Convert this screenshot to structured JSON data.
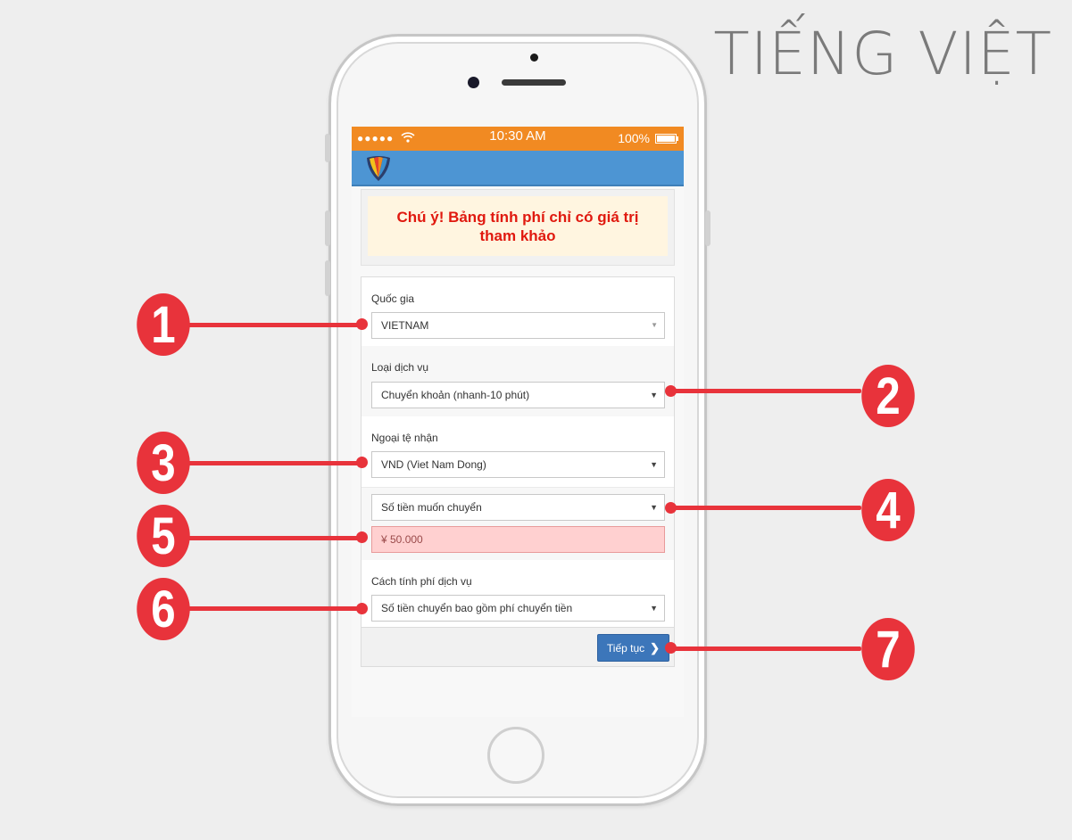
{
  "heading": "TIẾNG VIỆT",
  "status_bar": {
    "signal": "●●●●●",
    "time": "10:30 AM",
    "battery": "100%"
  },
  "notice": "Chú ý! Bảng tính phí chỉ có giá trị tham khảo",
  "form": {
    "country": {
      "label": "Quốc gia",
      "value": "VIETNAM"
    },
    "service_type": {
      "label": "Loại dịch vụ",
      "value": "Chuyển khoản (nhanh-10 phút)"
    },
    "currency": {
      "label": "Ngoại tệ nhận",
      "value": "VND (Viet Nam Dong)"
    },
    "amount_type": {
      "value": "Số tiền muốn chuyển"
    },
    "amount": {
      "value": "¥ 50.000"
    },
    "fee_method": {
      "label": "Cách tính phí dịch vụ",
      "value": "Số tiền chuyển bao gồm phí chuyển tiền"
    },
    "next_button": "Tiếp tục"
  },
  "callouts": [
    "1",
    "2",
    "3",
    "4",
    "5",
    "6",
    "7"
  ],
  "colors": {
    "callout": "#e8333b",
    "status_bar": "#f18a22",
    "app_bar": "#4d95d3",
    "button": "#3c76ba"
  }
}
